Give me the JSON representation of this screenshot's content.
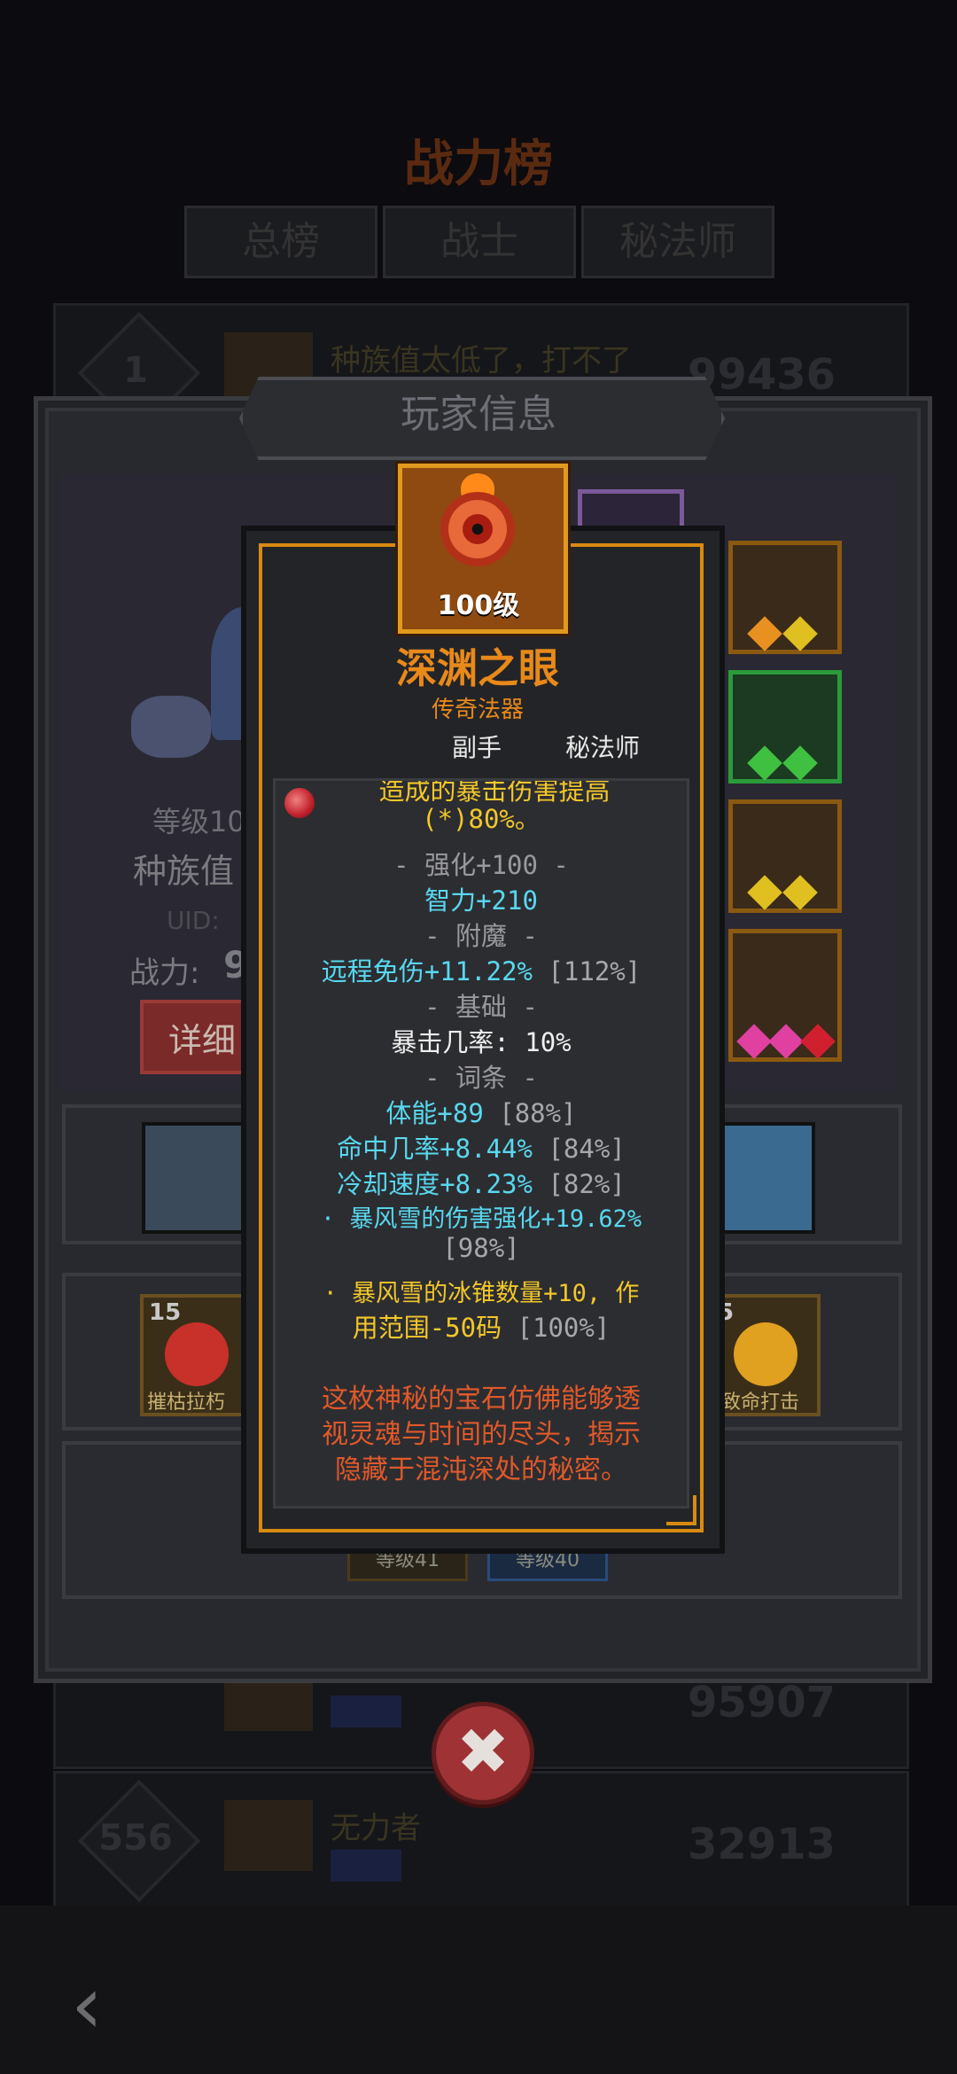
{
  "background": {
    "title": "战力榜",
    "tabs": [
      "总榜",
      "战士",
      "秘法师"
    ],
    "rows": [
      {
        "rank": "1",
        "name": "种族值太低了，打不了",
        "score": "99436"
      },
      {
        "rank": "",
        "name": "",
        "score": "95907"
      },
      {
        "rank": "556",
        "name": "无力者",
        "score": "32913"
      }
    ]
  },
  "panel": {
    "title": "玩家信息",
    "level_label": "等级100",
    "race_label": "种族值",
    "uid_label": "UID:",
    "power_label": "战力:",
    "power_value": "9",
    "detail_button": "详细",
    "talents": [
      {
        "count": "15",
        "label": "摧枯拉朽"
      },
      {
        "count": "5",
        "label": "致命打击"
      }
    ],
    "bottom_tags": [
      "等级41",
      "等级40"
    ]
  },
  "tooltip": {
    "level": "100级",
    "name": "深渊之眼",
    "quality": "传奇法器",
    "slot": "副手",
    "class": "秘法师",
    "top_line_1": "造成的暴击伤害提高",
    "top_line_2": "(*)80%。",
    "sections": {
      "enhance": "- 强化+100 -",
      "enchant": "- 附魔 -",
      "base": "- 基础 -",
      "affix": "- 词条 -"
    },
    "enhance_stat": "智力+210",
    "enchant_stat": "远程免伤+11.22%",
    "enchant_pct": "[112%]",
    "base_stat": "暴击几率: 10%",
    "affix_1": "体能+89",
    "affix_1_pct": "[88%]",
    "affix_2": "命中几率+8.44%",
    "affix_2_pct": "[84%]",
    "affix_3": "冷却速度+8.23%",
    "affix_3_pct": "[82%]",
    "affix_4": "· 暴风雪的伤害强化+19.62%",
    "affix_4_pct": "[98%]",
    "affix_5_line1": "· 暴风雪的冰锥数量+10, 作",
    "affix_5_line2": "用范围-50码",
    "affix_5_pct": "[100%]",
    "flavor_1": "这枚神秘的宝石仿佛能够透",
    "flavor_2": "视灵魂与时间的尽头，揭示",
    "flavor_3": "隐藏于混沌深处的秘密。"
  },
  "close_icon": "close-x-icon",
  "back_icon": "chevron-left-icon"
}
